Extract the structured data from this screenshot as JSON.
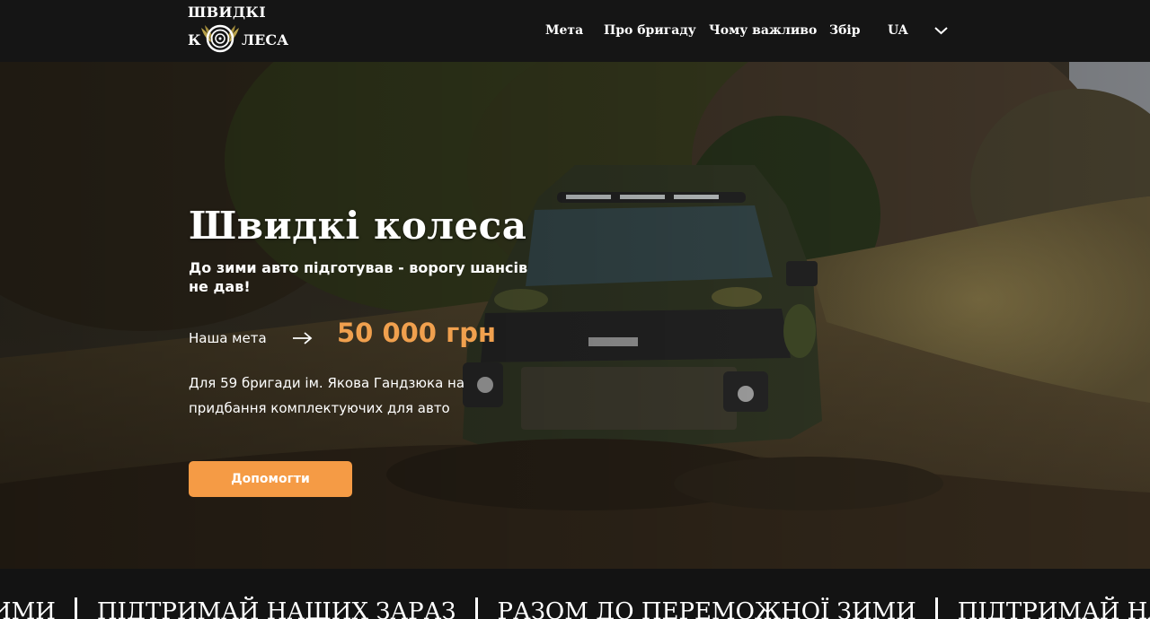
{
  "logo": {
    "line1": "ШВИДКІ",
    "line2_start": "К",
    "line2_end": "ЛЕСА",
    "icon": "wheel-with-wings-icon"
  },
  "nav": {
    "items": [
      "Мета",
      "Про бригаду",
      "Чому важливо",
      "Збір"
    ],
    "language": "UA",
    "dropdown_icon": "chevron-down-icon"
  },
  "hero": {
    "title": "Швидкі колеса",
    "subtitle": "До зими авто підготував - ворогу шансів не дав!",
    "goal_label": "Наша мета",
    "goal_icon": "arrow-right-icon",
    "goal_amount": "50 000 грн",
    "description": "Для 59 бригади ім. Якова Гандзюка на придбання комплектуючих для авто",
    "button_label": "Допомогти",
    "background": "military-pickup-truck-in-mud-photo"
  },
  "ticker": {
    "items": [
      "ЖНОЇ ЗИМИ",
      "ПІДТРИМАЙ НАШИХ ЗАРАЗ",
      "РАЗОМ ДО ПЕРЕМОЖНОЇ ЗИМИ",
      "ПІДТРИМАЙ НАШИХ"
    ]
  },
  "colors": {
    "accent": "#f59b45",
    "goal_amount": "#f0a04e",
    "header_bg": "#151515"
  }
}
